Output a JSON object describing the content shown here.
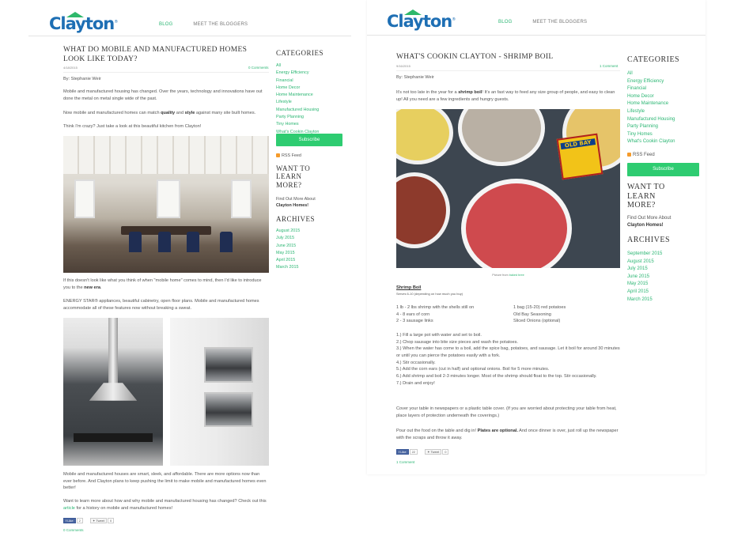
{
  "nav": {
    "blog": "BLOG",
    "bloggers": "MEET THE BLOGGERS"
  },
  "logo": {
    "text": "Clayton",
    "mark": "®"
  },
  "colors": {
    "accent": "#2bb673",
    "brand_blue": "#1e6fb4",
    "button": "#2ecc71"
  },
  "left_post": {
    "title": "WHAT DO MOBILE AND MANUFACTURED HOMES LOOK LIKE TODAY?",
    "date": "4/18/2015",
    "comments_top": "0 Comments",
    "author": "By: Stephanie Weir",
    "p1a": "Mobile and manufactured housing has changed. Over the years, technology and innovations have out done the metal on metal single wide of the past.",
    "p2a": "Now mobile and manufactured homes can match ",
    "p2b": "quality",
    "p2c": " and ",
    "p2d": "style",
    "p2e": " against many site built homes.",
    "p3": "Think I'm crazy? Just take a look at this beautiful kitchen from Clayton!",
    "p4a": "If this doesn't look like what you think of when \"mobile home\" comes to mind, then I'd like to introduce you to the ",
    "p4b": "new era",
    "p4c": ".",
    "p5": "ENERGY STAR® appliances, beautiful cabinetry, open floor plans. Mobile and manufactured homes accommodate all of these features now without breaking a sweat.",
    "p6": "Mobile and manufactured houses are smart, sleek, and affordable. There are more options now than ever before. And Clayton plans to keep pushing the limit to make mobile and manufactured homes even better!",
    "p7a": "Want to learn more about how and why mobile and manufactured housing has changed? Check out this ",
    "p7b": "article",
    "p7c": " for a history on mobile and manufactured homes!",
    "like_label": "Like",
    "like_count": "2",
    "tweet_label": "Tweet",
    "tweet_count": "0",
    "comments_bottom": "0 Comments"
  },
  "left_sidebar": {
    "categories_title": "CATEGORIES",
    "categories": [
      "All",
      "Energy Efficiency",
      "Financial",
      "Home Decor",
      "Home Maintenance",
      "Lifestyle",
      "Manufactured Housing",
      "Party Planning",
      "Tiny Homes",
      "What's Cookin Clayton"
    ],
    "subscribe": "Subscribe",
    "rss": "RSS Feed",
    "learn_title": "WANT TO LEARN MORE?",
    "find_out": "Find Out More About",
    "clayton_homes": "Clayton Homes!",
    "archives_title": "ARCHIVES",
    "archives": [
      "August 2015",
      "July 2015",
      "June 2015",
      "May 2015",
      "April 2015",
      "March 2015"
    ]
  },
  "right_post": {
    "title": "WHAT'S COOKIN CLAYTON - SHRIMP BOIL",
    "date": "9/16/2015",
    "comments_top": "1 Comment",
    "author": "By: Stephanie Weir",
    "p1a": "It's not too late in the year for a ",
    "p1b": "shrimp boil",
    "p1c": "! It's an fast way to feed any size group of people, and easy to clean up! All you need are a few ingredients and hungry guests.",
    "box_text": "OLD BAY",
    "caption_a": "Picture from ",
    "caption_b": "baked bree",
    "recipe_title": "Shrimp Boil",
    "serves": "Serves 6-10 (depending on how much you buy)",
    "ingredients_left": [
      "1 lb - 2 lbs shrimp with the shells still on",
      "4 - 8 ears of corn",
      "2 - 3 sausage links"
    ],
    "ingredients_right": [
      "1 bag (15-20) red potatoes",
      "Old Bay Seasoning",
      "Sliced Onions (optional)"
    ],
    "steps": [
      "1.) Fill a large pot with water and set to boil.",
      "2.) Chop sausage into bite size pieces and wash the potatoes.",
      "3.) When the water has come to a boil, add the spice bag, potatoes, and sausage. Let it boil for around 30 minutes or until you can pierce the potatoes easily with a fork.",
      "4.) Stir occasionally.",
      "5.) Add the corn ears (cut in half) and optional onions. Boil for 5 more minutes.",
      "6.) Add shrimp and boil 2-3 minutes longer. Most of the shrimp should float to the top. Stir occasionally.",
      "7.) Drain and enjoy!"
    ],
    "cover": "Cover your table in newspapers or a plastic table cover. (If you are worried about protecting your table from heat, place layers of protection underneath the coverings.)",
    "pour_a": "Pour out the food on the table and dig in! ",
    "pour_b": "Plates are optional.",
    "pour_c": " And once dinner is over, just roll up the newspaper with the scraps and throw it away.",
    "like_label": "Like",
    "like_count": "22",
    "tweet_label": "Tweet",
    "tweet_count": "0",
    "comments_bottom": "1 Comment"
  },
  "right_sidebar": {
    "categories_title": "CATEGORIES",
    "categories": [
      "All",
      "Energy Efficiency",
      "Financial",
      "Home Decor",
      "Home Maintenance",
      "Lifestyle",
      "Manufactured Housing",
      "Party Planning",
      "Tiny Homes",
      "What's Cookin Clayton"
    ],
    "rss": "RSS Feed",
    "subscribe": "Subscribe",
    "learn_title": "WANT TO LEARN MORE?",
    "find_out": "Find Out More About",
    "clayton_homes": "Clayton Homes!",
    "archives_title": "ARCHIVES",
    "archives": [
      "September 2015",
      "August 2015",
      "July 2015",
      "June 2015",
      "May 2015",
      "April 2015",
      "March 2015"
    ]
  }
}
